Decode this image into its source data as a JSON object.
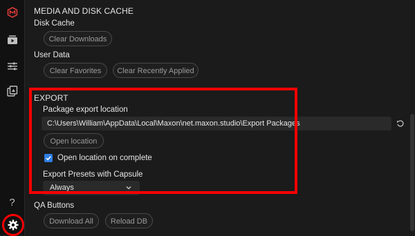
{
  "sidebar": {
    "help_label": "?"
  },
  "media_cache": {
    "title": "MEDIA AND DISK CACHE",
    "disk_cache_label": "Disk Cache",
    "clear_downloads": "Clear Downloads",
    "user_data_label": "User Data",
    "clear_favorites": "Clear Favorites",
    "clear_recent": "Clear Recently Applied"
  },
  "export": {
    "title": "EXPORT",
    "location_label": "Package export location",
    "location_value": "C:\\Users\\William\\AppData\\Local\\Maxon\\net.maxon.studio\\Export Packages",
    "open_location": "Open location",
    "open_on_complete": "Open location on complete",
    "open_on_complete_checked": true,
    "presets_label": "Export Presets with Capsule",
    "presets_value": "Always"
  },
  "qa": {
    "title": "QA Buttons",
    "download_all": "Download All",
    "reload_db": "Reload DB"
  },
  "colors": {
    "accent": "#2f7fe6",
    "highlight": "#ff0000",
    "logo": "#d93a3a"
  }
}
